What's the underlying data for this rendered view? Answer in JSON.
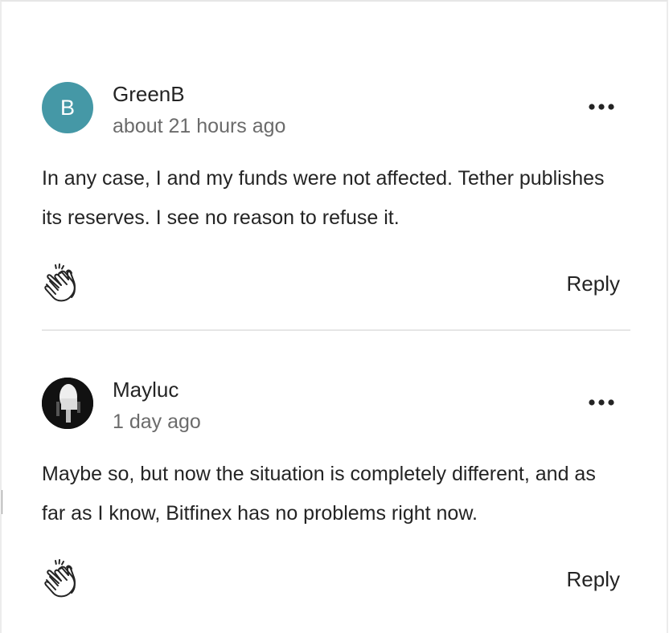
{
  "comments": [
    {
      "avatar_letter": "B",
      "avatar_color": "#4598a6",
      "author": "GreenB",
      "time": "about 21 hours ago",
      "text": "In any case, I and my funds were not affected. Tether publishes its reserves. I see no reason to refuse it.",
      "clap_icon": "clap-icon",
      "more_icon": "more-options-icon",
      "reply_label": "Reply"
    },
    {
      "avatar_letter": "",
      "avatar_color": "#111111",
      "author": "Mayluc",
      "time": "1 day ago",
      "text": "Maybe so, but now the situation is completely different, and as far as I know, Bitfinex has no problems right now.",
      "clap_icon": "clap-icon",
      "more_icon": "more-options-icon",
      "reply_label": "Reply"
    }
  ]
}
